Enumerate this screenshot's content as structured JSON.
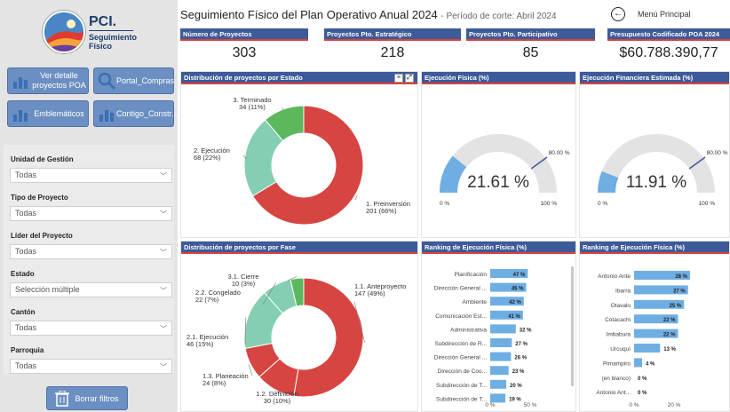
{
  "header": {
    "title": "Seguimiento Físico del Plan Operativo Anual 2024",
    "subtitle": "- Período de corte: Abril 2024",
    "menu_label": "Menú Principal"
  },
  "logo": {
    "title": "PCI.",
    "subtitle": "Seguimiento Físico"
  },
  "nav": {
    "detail": "Ver detalle proyectos POA",
    "portal": "Portal_Compras",
    "emblematicos": "Emblemáticos",
    "contigo": "Contigo_Constr..."
  },
  "filters": [
    {
      "label": "Unidad de Gestión",
      "value": "Todas"
    },
    {
      "label": "Tipo de Proyecto",
      "value": "Todas"
    },
    {
      "label": "Líder del Proyecto",
      "value": "Todas"
    },
    {
      "label": "Estado",
      "value": "Selección múltiple"
    },
    {
      "label": "Cantón",
      "value": "Todas"
    },
    {
      "label": "Parroquia",
      "value": "Todas"
    }
  ],
  "reset_label": "Borrar filtros",
  "kpis": [
    {
      "label": "Número de Proyectos",
      "value": "303"
    },
    {
      "label": "Proyectos Pto. Estratégico",
      "value": "218"
    },
    {
      "label": "Proyectos Pto. Participativo",
      "value": "85"
    },
    {
      "label": "Presupuesto Codificado POA 2024",
      "value": "$60.788.390,77"
    }
  ],
  "panels": {
    "estado": "Distribución de proyectos por Estado",
    "fase": "Distribución de proyectos por Fase",
    "ejec_fisica": "Ejecución Física (%)",
    "ejec_financiera": "Ejecución Financiera Estimada (%)",
    "rank1": "Ranking de Ejecución Física (%)",
    "rank2": "Ranking de Ejecución Física (%)"
  },
  "colors": {
    "red": "#d64541",
    "teal": "#84cfb1",
    "green": "#5cb85c",
    "blue": "#6faee3",
    "header": "#3d5a99"
  },
  "chart_data": [
    {
      "type": "pie",
      "title": "Distribución de proyectos por Estado",
      "slices": [
        {
          "label": "1. Preinversión",
          "value": 201,
          "pct": "201 (66%)",
          "color": "#d64541"
        },
        {
          "label": "2. Ejecución",
          "value": 68,
          "pct": "68 (22%)",
          "color": "#84cfb1"
        },
        {
          "label": "3. Terminado",
          "value": 34,
          "pct": "34 (11%)",
          "color": "#5cb85c"
        }
      ]
    },
    {
      "type": "pie",
      "title": "Distribución de proyectos por Fase",
      "slices": [
        {
          "label": "1.1. Anteproyecto",
          "value": 147,
          "pct": "147 (49%)",
          "color": "#d64541"
        },
        {
          "label": "1.2. Definición",
          "value": 30,
          "pct": "30 (10%)",
          "color": "#d64541"
        },
        {
          "label": "1.3. Planeación",
          "value": 24,
          "pct": "24 (8%)",
          "color": "#d64541"
        },
        {
          "label": "2.1. Ejecución",
          "value": 46,
          "pct": "46 (15%)",
          "color": "#84cfb1"
        },
        {
          "label": "2.2. Congelado",
          "value": 22,
          "pct": "22 (7%)",
          "color": "#84cfb1"
        },
        {
          "label": "3.1. Cierre",
          "value": 10,
          "pct": "10 (3%)",
          "color": "#5cb85c"
        }
      ]
    },
    {
      "type": "gauge",
      "title": "Ejecución Física (%)",
      "value": 21.61,
      "value_label": "21.61 %",
      "target": 80,
      "target_label": "80.00 %",
      "min_label": "0 %",
      "max_label": "100 %"
    },
    {
      "type": "gauge",
      "title": "Ejecución Financiera Estimada (%)",
      "value": 11.91,
      "value_label": "11.91 %",
      "target": 80,
      "target_label": "80.00 %",
      "min_label": "0 %",
      "max_label": "100 %"
    },
    {
      "type": "bar",
      "title": "Ranking de Ejecución Física (%)",
      "categories": [
        "Planificación",
        "Dirección General ...",
        "Ambiente",
        "Comunicación Est...",
        "Administrativa",
        "Subdirección de R...",
        "Dirección General ...",
        "Dirección de Coo...",
        "Subdirección de T...",
        "Subdirección de T..."
      ],
      "values": [
        47,
        45,
        42,
        41,
        32,
        27,
        26,
        23,
        20,
        19
      ],
      "value_labels": [
        "47 %",
        "45 %",
        "42 %",
        "41 %",
        "32 %",
        "27 %",
        "26 %",
        "23 %",
        "20 %",
        "19 %"
      ],
      "xticks": [
        "0 %",
        "50 %"
      ],
      "xlim": [
        0,
        100
      ]
    },
    {
      "type": "bar",
      "title": "Ranking de Ejecución Física (%)",
      "categories": [
        "Antonio Ante",
        "Ibarra",
        "Otavalo",
        "Cotacachi",
        "Imbabura",
        "Urcuquí",
        "Pimampiro",
        "(en blanco)",
        "Antonio Ant..."
      ],
      "values": [
        28,
        27,
        25,
        22,
        22,
        13,
        4,
        0,
        0
      ],
      "value_labels": [
        "28 %",
        "27 %",
        "25 %",
        "22 %",
        "22 %",
        "13 %",
        "4 %",
        "0 %",
        "0 %"
      ],
      "xticks": [
        "0 %",
        "20 %"
      ],
      "xlim": [
        0,
        40
      ]
    }
  ]
}
